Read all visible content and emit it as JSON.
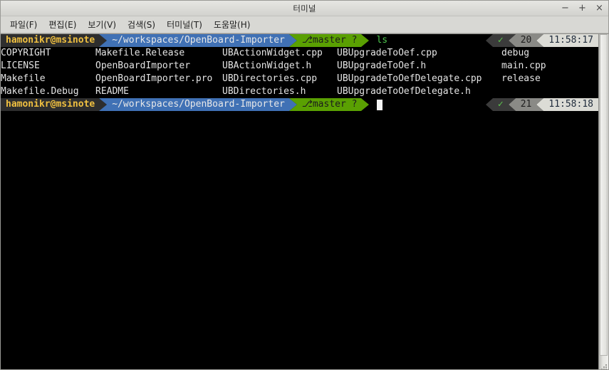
{
  "window": {
    "title": "터미널",
    "buttons": {
      "minimize": "−",
      "maximize": "+",
      "close": "×"
    }
  },
  "menubar": {
    "items": [
      {
        "label": "파일(F)",
        "name": "menu-file"
      },
      {
        "label": "편집(E)",
        "name": "menu-edit"
      },
      {
        "label": "보기(V)",
        "name": "menu-view"
      },
      {
        "label": "검색(S)",
        "name": "menu-search"
      },
      {
        "label": "터미널(T)",
        "name": "menu-terminal"
      },
      {
        "label": "도움말(H)",
        "name": "menu-help"
      }
    ]
  },
  "terminal": {
    "prompt1": {
      "user": "hamonikr@msinote",
      "path": "~/workspaces/OpenBoard-Importer",
      "git_icon": "⎇",
      "git": "master ?",
      "command": "ls",
      "status_check": "✓",
      "status_count": "20",
      "status_time": "11:58:17"
    },
    "prompt2": {
      "user": "hamonikr@msinote",
      "path": "~/workspaces/OpenBoard-Importer",
      "git_icon": "⎇",
      "git": "master ?",
      "command": "",
      "status_check": "✓",
      "status_count": "21",
      "status_time": "11:58:18"
    },
    "ls_columns": [
      [
        "COPYRIGHT",
        "LICENSE",
        "Makefile",
        "Makefile.Debug"
      ],
      [
        "Makefile.Release",
        "OpenBoardImporter",
        "OpenBoardImporter.pro",
        "README"
      ],
      [
        "UBActionWidget.cpp",
        "UBActionWidget.h",
        "UBDirectories.cpp",
        "UBDirectories.h"
      ],
      [
        "UBUpgradeToOef.cpp",
        "UBUpgradeToOef.h",
        "UBUpgradeToOefDelegate.cpp",
        "UBUpgradeToOefDelegate.h"
      ],
      [
        "debug",
        "main.cpp",
        "release"
      ]
    ]
  },
  "colors": {
    "user_bg": "#2e2e2e",
    "user_fg": "#f0c040",
    "path_bg": "#4071b5",
    "path_fg": "#e8e8e8",
    "git_bg": "#5aa002",
    "git_fg": "#1c1c1c",
    "command_fg": "#4ec94e",
    "check_fg": "#5ec94e",
    "count_bg": "#8a8a86",
    "time_bg": "#dcdcd6",
    "terminal_bg": "#000000",
    "text_fg": "#e4e4e4"
  }
}
